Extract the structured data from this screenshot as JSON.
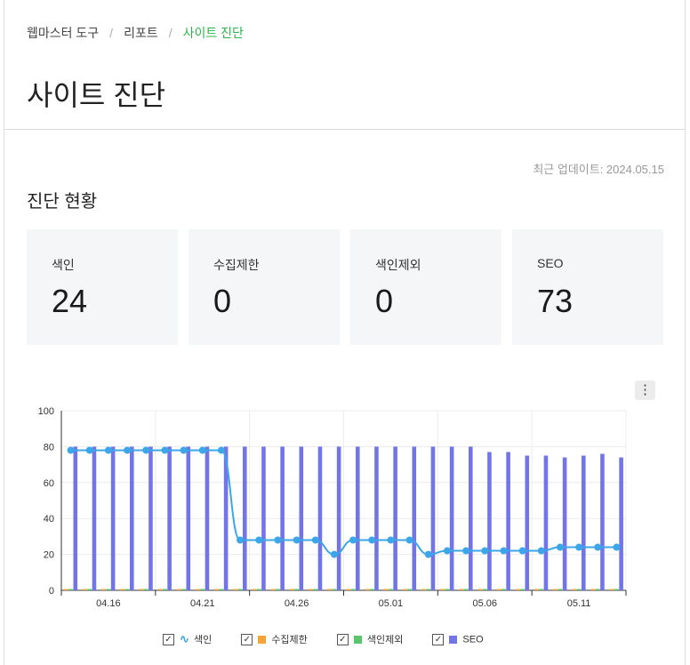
{
  "breadcrumb": {
    "items": [
      "웹마스터 도구",
      "리포트"
    ],
    "separator": "/",
    "current": "사이트 진단"
  },
  "page_title": "사이트 진단",
  "last_updated": "최근 업데이트: 2024.05.15",
  "section_title": "진단 현황",
  "cards": [
    {
      "label": "색인",
      "value": "24"
    },
    {
      "label": "수집제한",
      "value": "0"
    },
    {
      "label": "색인제외",
      "value": "0"
    },
    {
      "label": "SEO",
      "value": "73"
    }
  ],
  "menu_icon": "vertical-dots-icon",
  "colors": {
    "index": "#3ba6e8",
    "crawl_limit": "#f7a436",
    "excluded": "#58c76c",
    "seo": "#7275e6",
    "accent": "#2db34a"
  },
  "legend": [
    {
      "label": "색인",
      "checked": true,
      "icon": "line-icon"
    },
    {
      "label": "수집제한",
      "checked": true,
      "icon": "square-icon"
    },
    {
      "label": "색인제외",
      "checked": true,
      "icon": "square-icon"
    },
    {
      "label": "SEO",
      "checked": true,
      "icon": "square-icon"
    }
  ],
  "chart_data": {
    "type": "bar",
    "x": [
      "04.14",
      "04.15",
      "04.16",
      "04.17",
      "04.18",
      "04.19",
      "04.20",
      "04.21",
      "04.22",
      "04.23",
      "04.24",
      "04.25",
      "04.26",
      "04.27",
      "04.28",
      "04.29",
      "04.30",
      "05.01",
      "05.02",
      "05.03",
      "05.04",
      "05.05",
      "05.06",
      "05.07",
      "05.08",
      "05.09",
      "05.10",
      "05.11",
      "05.12",
      "05.13"
    ],
    "x_tick_labels": [
      "04.16",
      "04.21",
      "04.26",
      "05.01",
      "05.06",
      "05.11"
    ],
    "ylim": [
      0,
      100
    ],
    "y_ticks": [
      0,
      20,
      40,
      60,
      80,
      100
    ],
    "grid": true,
    "legend_position": "bottom",
    "series": [
      {
        "name": "색인",
        "type": "line",
        "values": [
          78,
          78,
          78,
          78,
          78,
          78,
          78,
          78,
          78,
          28,
          28,
          28,
          28,
          28,
          20,
          28,
          28,
          28,
          28,
          20,
          22,
          22,
          22,
          22,
          22,
          22,
          24,
          24,
          24,
          24
        ]
      },
      {
        "name": "수집제한",
        "type": "bar",
        "values": [
          0,
          0,
          0,
          0,
          0,
          0,
          0,
          0,
          0,
          0,
          0,
          0,
          0,
          0,
          0,
          0,
          0,
          0,
          0,
          0,
          0,
          0,
          0,
          0,
          0,
          0,
          0,
          0,
          0,
          0
        ]
      },
      {
        "name": "색인제외",
        "type": "bar",
        "values": [
          0,
          0,
          0,
          0,
          0,
          0,
          0,
          0,
          0,
          0,
          0,
          0,
          0,
          0,
          0,
          0,
          0,
          0,
          0,
          0,
          0,
          0,
          0,
          0,
          0,
          0,
          0,
          0,
          0,
          0
        ]
      },
      {
        "name": "SEO",
        "type": "bar",
        "values": [
          80,
          80,
          80,
          80,
          80,
          80,
          80,
          80,
          80,
          80,
          80,
          80,
          80,
          80,
          80,
          80,
          80,
          80,
          80,
          80,
          80,
          80,
          77,
          77,
          75,
          75,
          74,
          75,
          76,
          74
        ]
      }
    ]
  }
}
